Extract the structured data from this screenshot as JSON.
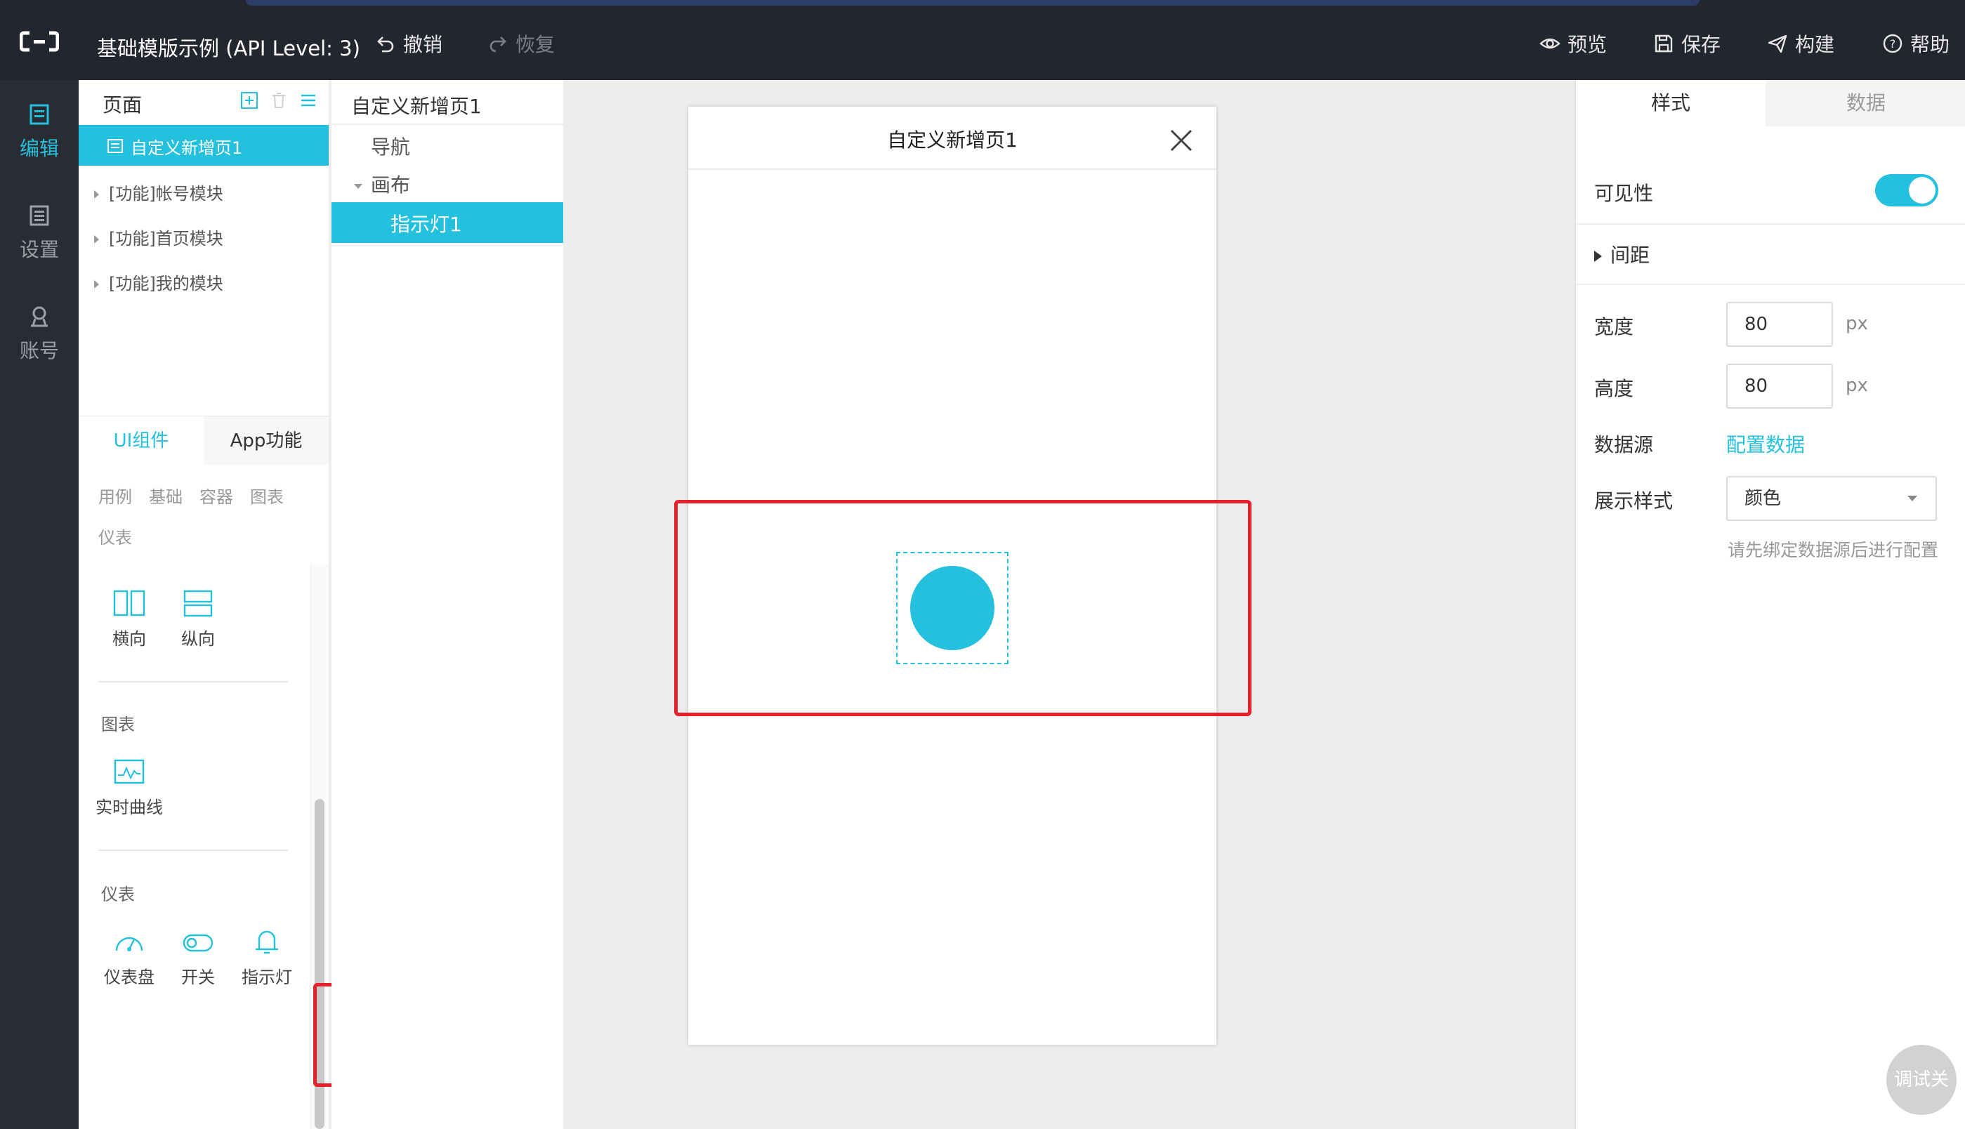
{
  "topbar": {
    "title": "基础模版示例 (API Level: 3)",
    "undo": "撤销",
    "redo": "恢复",
    "preview": "预览",
    "save": "保存",
    "build": "构建",
    "help": "帮助"
  },
  "leftnav": {
    "items": [
      {
        "label": "编辑",
        "icon": "edit-icon",
        "active": true
      },
      {
        "label": "设置",
        "icon": "settings-icon",
        "active": false
      },
      {
        "label": "账号",
        "icon": "account-icon",
        "active": false
      }
    ]
  },
  "pages": {
    "title": "页面",
    "active": "自定义新增页1",
    "items": [
      "[功能]帐号模块",
      "[功能]首页模块",
      "[功能]我的模块"
    ]
  },
  "components": {
    "tabs": [
      "UI组件",
      "App功能"
    ],
    "categories": [
      "用例",
      "基础",
      "容器",
      "图表",
      "仪表"
    ],
    "layout": [
      "横向",
      "纵向"
    ],
    "chart_section": "图表",
    "chart_items": [
      "实时曲线"
    ],
    "gauge_section": "仪表",
    "gauge_items": [
      "仪表盘",
      "开关",
      "指示灯"
    ]
  },
  "tree": {
    "title": "自定义新增页1",
    "nav": "导航",
    "canvas": "画布",
    "selected": "指示灯1"
  },
  "phone": {
    "title": "自定义新增页1"
  },
  "props": {
    "tabs": [
      "样式",
      "数据"
    ],
    "visibility": "可见性",
    "spacing": "间距",
    "width_label": "宽度",
    "width_value": "80",
    "height_label": "高度",
    "height_value": "80",
    "unit": "px",
    "datasource_label": "数据源",
    "datasource_link": "配置数据",
    "display_label": "展示样式",
    "display_value": "颜色",
    "hint": "请先绑定数据源后进行配置",
    "debug": "调试关"
  },
  "colors": {
    "accent": "#23c1de",
    "highlight": "#e5202a",
    "topbar": "#24262f"
  }
}
